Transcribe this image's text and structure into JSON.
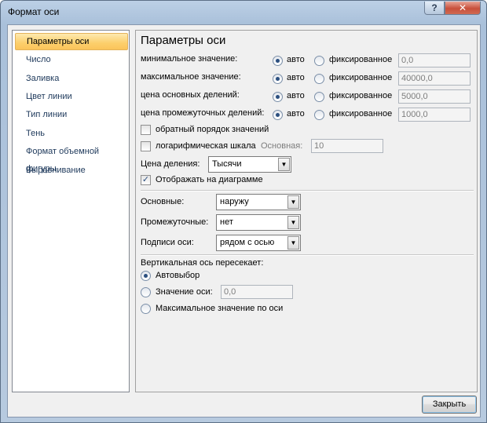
{
  "window": {
    "title": "Формат оси"
  },
  "titlebar": {
    "help_glyph": "?",
    "close_glyph": "✕"
  },
  "nav": {
    "items": [
      {
        "label": "Параметры оси",
        "selected": true
      },
      {
        "label": "Число"
      },
      {
        "label": "Заливка"
      },
      {
        "label": "Цвет линии"
      },
      {
        "label": "Тип линии"
      },
      {
        "label": "Тень"
      },
      {
        "label": "Формат объемной фигуры"
      },
      {
        "label": "Выравнивание"
      }
    ]
  },
  "panel": {
    "title": "Параметры оси",
    "scale_rows": [
      {
        "label": "минимальное значение:",
        "auto": "авто",
        "fixed": "фиксированное",
        "value": "0,0"
      },
      {
        "label": "максимальное значение:",
        "auto": "авто",
        "fixed": "фиксированное",
        "value": "40000,0"
      },
      {
        "label": "цена основных делений:",
        "auto": "авто",
        "fixed": "фиксированное",
        "value": "5000,0"
      },
      {
        "label": "цена промежуточных делений:",
        "auto": "авто",
        "fixed": "фиксированное",
        "value": "1000,0"
      }
    ],
    "reverse_order": {
      "label": "обратный порядок значений",
      "checked": false
    },
    "log_scale": {
      "label": "логарифмическая шкала",
      "base_label": "Основная:",
      "base_value": "10",
      "checked": false
    },
    "display_units": {
      "label": "Цена деления:",
      "value": "Тысячи"
    },
    "show_on_chart": {
      "label": "Отображать на диаграмме",
      "checked": true
    },
    "major_ticks": {
      "label": "Основные:",
      "value": "наружу"
    },
    "minor_ticks": {
      "label": "Промежуточные:",
      "value": "нет"
    },
    "axis_labels": {
      "label": "Подписи оси:",
      "value": "рядом с осью"
    },
    "crosses": {
      "heading": "Вертикальная ось пересекает:",
      "auto": "Автовыбор",
      "value_label": "Значение оси:",
      "value": "0,0",
      "max": "Максимальное значение по оси"
    }
  },
  "footer": {
    "close_label": "Закрыть"
  }
}
